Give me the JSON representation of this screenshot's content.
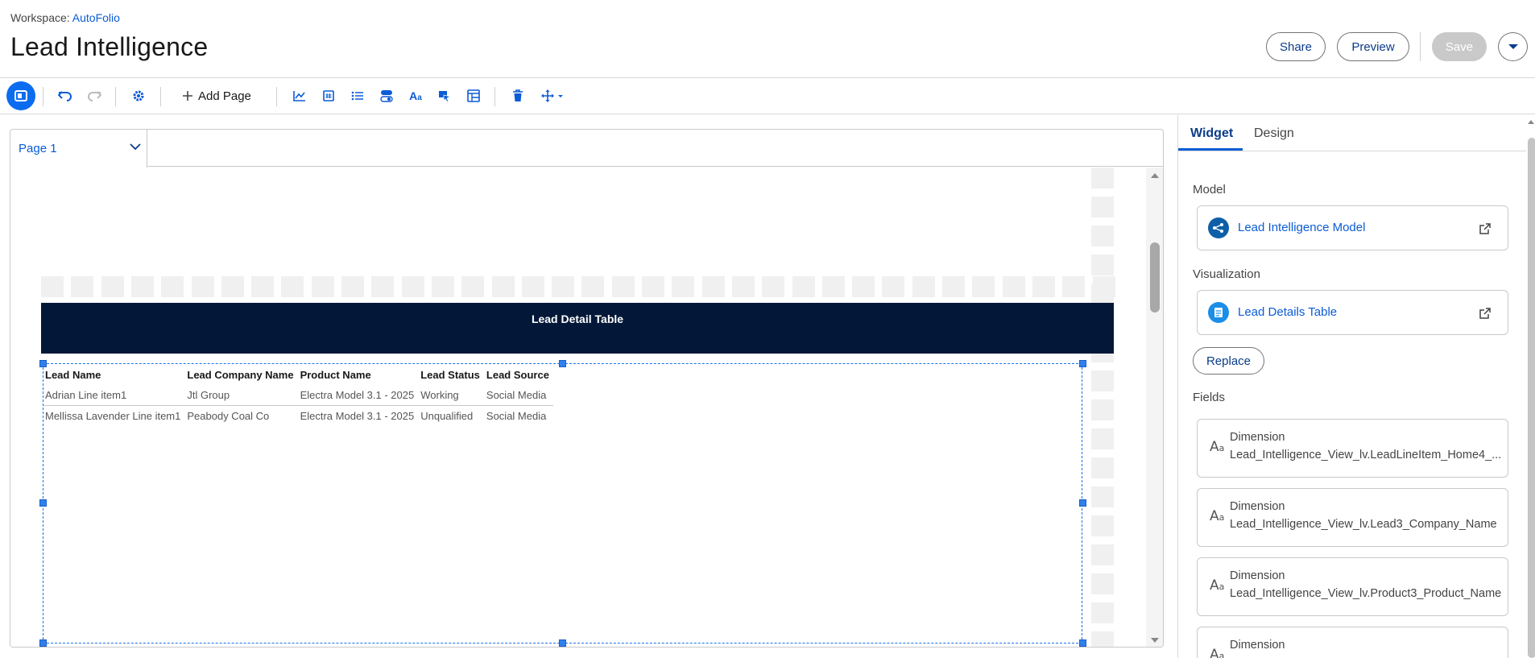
{
  "header": {
    "workspace_label": "Workspace:",
    "workspace_name": "AutoFolio",
    "title": "Lead Intelligence",
    "share": "Share",
    "preview": "Preview",
    "save": "Save"
  },
  "toolbar": {
    "add_page": "Add Page",
    "icons": [
      "panel-toggle-icon",
      "undo-icon",
      "redo-icon",
      "settings-icon",
      "add-icon",
      "chart-icon",
      "number-widget-icon",
      "list-icon",
      "toggle-icon",
      "text-icon",
      "image-icon",
      "table-icon",
      "delete-icon",
      "move-icon"
    ]
  },
  "canvas": {
    "page_tab": "Page 1",
    "banner_title": "Lead Detail Table",
    "table": {
      "columns": [
        "Lead Name",
        "Lead Company Name",
        "Product Name",
        "Lead Status",
        "Lead Source"
      ],
      "rows": [
        [
          "Adrian Line item1",
          "Jtl Group",
          "Electra Model 3.1 - 2025",
          "Working",
          "Social Media"
        ],
        [
          "Mellissa Lavender Line item1",
          "Peabody Coal Co",
          "Electra Model 3.1 - 2025",
          "Unqualified",
          "Social Media"
        ]
      ]
    }
  },
  "panel": {
    "tabs": [
      "Widget",
      "Design"
    ],
    "model_label": "Model",
    "model_name": "Lead Intelligence Model",
    "viz_label": "Visualization",
    "viz_name": "Lead Details Table",
    "replace": "Replace",
    "fields_label": "Fields",
    "fields": [
      {
        "type": "Dimension",
        "name": "Lead_Intelligence_View_lv.LeadLineItem_Home4_..."
      },
      {
        "type": "Dimension",
        "name": "Lead_Intelligence_View_lv.Lead3_Company_Name"
      },
      {
        "type": "Dimension",
        "name": "Lead_Intelligence_View_lv.Product3_Product_Name"
      },
      {
        "type": "Dimension",
        "name": ""
      }
    ]
  },
  "colors": {
    "accent": "#0b5cd5",
    "banner": "#031839",
    "active_button": "#0b6cf0"
  }
}
